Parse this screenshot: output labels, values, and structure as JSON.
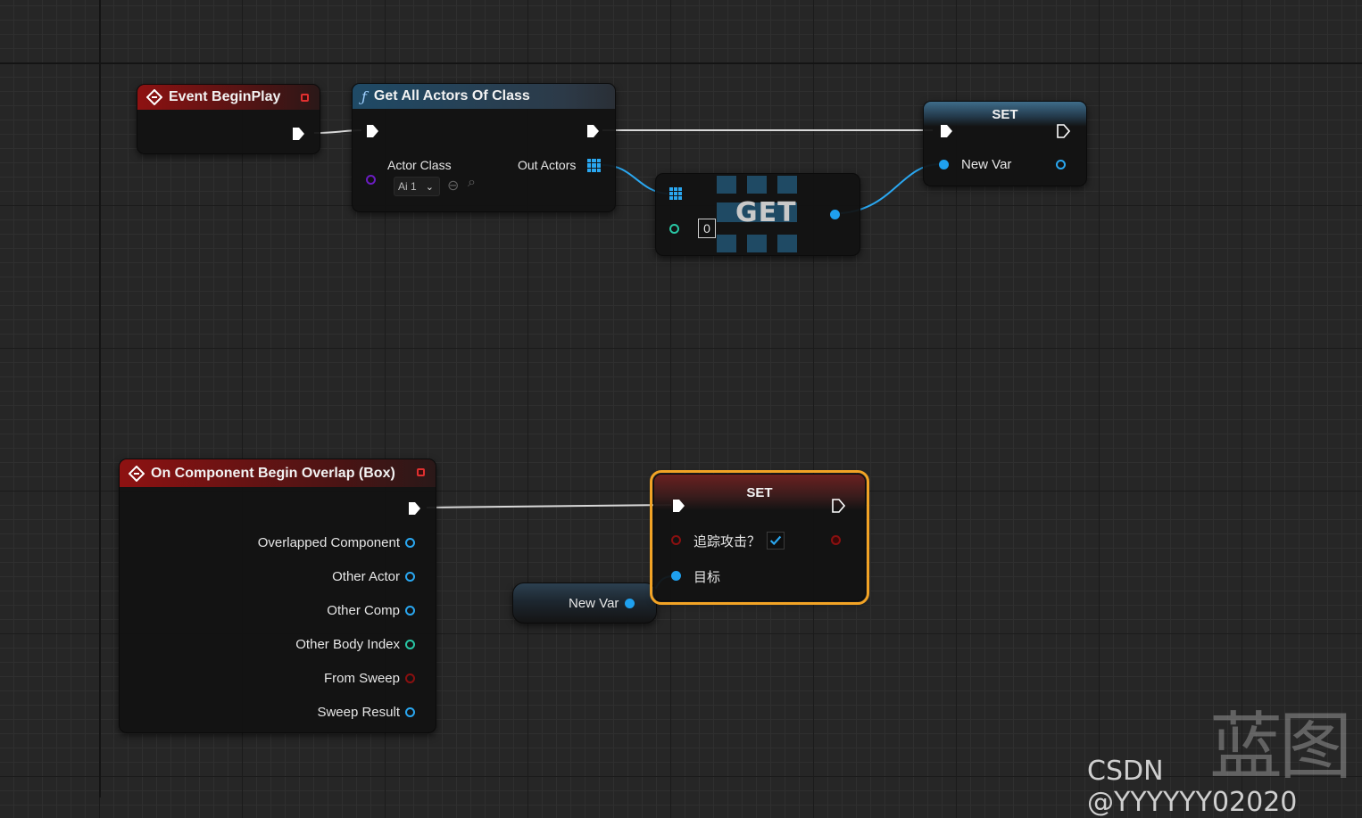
{
  "nodes": {
    "event_beginplay": {
      "title": "Event BeginPlay"
    },
    "get_all_actors": {
      "title": "Get All Actors Of Class",
      "actor_class_label": "Actor Class",
      "actor_class_value": "Ai 1",
      "out_actors_label": "Out Actors"
    },
    "get_node": {
      "title": "GET",
      "index": "0"
    },
    "set_top": {
      "title": "SET",
      "var_label": "New Var"
    },
    "overlap_event": {
      "title": "On Component Begin Overlap (Box)",
      "outputs": [
        "Overlapped Component",
        "Other Actor",
        "Other Comp",
        "Other Body Index",
        "From Sweep",
        "Sweep Result"
      ]
    },
    "set_bottom": {
      "title": "SET",
      "bool_label": "追踪攻击？",
      "bool_value": true,
      "target_label": "目标"
    },
    "new_var_getter": {
      "label": "New Var"
    }
  },
  "colors": {
    "object_pin": "#2aa7f0",
    "int_pin": "#29c7a5",
    "bool_pin": "#8a1010",
    "class_pin": "#6a1cc0",
    "event_header": "#8e1212",
    "selection": "#f2a325"
  },
  "watermark": {
    "logo": "蓝图",
    "text": "CSDN @YYYYYY02020"
  }
}
